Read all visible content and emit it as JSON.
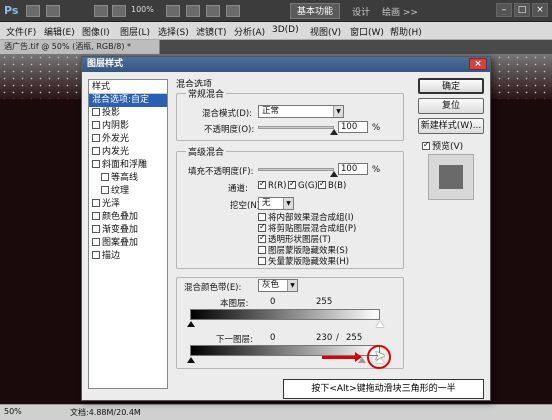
{
  "app": {
    "logo": "Ps",
    "zoom": "100%",
    "workspace_active": "基本功能",
    "workspace_2": "设计",
    "workspace_3": "绘画 >>",
    "window_buttons": [
      "–",
      "□",
      "×"
    ]
  },
  "menubar": [
    "文件(F)",
    "编辑(E)",
    "图像(I)",
    "图层(L)",
    "选择(S)",
    "滤镜(T)",
    "分析(A)",
    "3D(D)",
    "视图(V)",
    "窗口(W)",
    "帮助(H)"
  ],
  "document_tab": "酒广告.tif @ 50% (酒瓶, RGB/8) *",
  "status": {
    "zoom": "50%",
    "doc": "文档:4.88M/20.4M"
  },
  "dialog": {
    "title": "图层样式",
    "close": "×",
    "styles_header": "样式",
    "style_items": [
      {
        "label": "混合选项:自定",
        "checkbox": false,
        "checked": false,
        "selected": true,
        "indent": false
      },
      {
        "label": "投影",
        "checkbox": true,
        "checked": false,
        "selected": false,
        "indent": false
      },
      {
        "label": "内阴影",
        "checkbox": true,
        "checked": false,
        "selected": false,
        "indent": false
      },
      {
        "label": "外发光",
        "checkbox": true,
        "checked": false,
        "selected": false,
        "indent": false
      },
      {
        "label": "内发光",
        "checkbox": true,
        "checked": false,
        "selected": false,
        "indent": false
      },
      {
        "label": "斜面和浮雕",
        "checkbox": true,
        "checked": false,
        "selected": false,
        "indent": false
      },
      {
        "label": "等高线",
        "checkbox": true,
        "checked": false,
        "selected": false,
        "indent": true
      },
      {
        "label": "纹理",
        "checkbox": true,
        "checked": false,
        "selected": false,
        "indent": true
      },
      {
        "label": "光泽",
        "checkbox": true,
        "checked": false,
        "selected": false,
        "indent": false
      },
      {
        "label": "颜色叠加",
        "checkbox": true,
        "checked": false,
        "selected": false,
        "indent": false
      },
      {
        "label": "渐变叠加",
        "checkbox": true,
        "checked": false,
        "selected": false,
        "indent": false
      },
      {
        "label": "图案叠加",
        "checkbox": true,
        "checked": false,
        "selected": false,
        "indent": false
      },
      {
        "label": "描边",
        "checkbox": true,
        "checked": false,
        "selected": false,
        "indent": false
      }
    ],
    "blend_options_title": "混合选项",
    "general": {
      "title": "常规混合",
      "mode_label": "混合模式(D):",
      "mode_value": "正常",
      "opacity_label": "不透明度(O):",
      "opacity_value": "100",
      "opacity_fraction": 1.0,
      "percent": "%"
    },
    "advanced": {
      "title": "高级混合",
      "fill_label": "填充不透明度(F):",
      "fill_value": "100",
      "fill_fraction": 1.0,
      "percent": "%",
      "channels_label": "通道:",
      "channels": [
        {
          "label": "R(R)",
          "checked": true
        },
        {
          "label": "G(G)",
          "checked": true
        },
        {
          "label": "B(B)",
          "checked": true
        }
      ],
      "knockout_label": "挖空(N):",
      "knockout_value": "无",
      "options": [
        {
          "label": "将内部效果混合成组(I)",
          "checked": false
        },
        {
          "label": "将剪贴图层混合成组(P)",
          "checked": true
        },
        {
          "label": "透明形状图层(T)",
          "checked": true
        },
        {
          "label": "图层蒙版隐藏效果(S)",
          "checked": false
        },
        {
          "label": "矢量蒙版隐藏效果(H)",
          "checked": false
        }
      ]
    },
    "blend_if": {
      "label": "混合颜色带(E):",
      "value": "灰色",
      "this_layer_label": "本图层:",
      "this_layer_low": "0",
      "this_layer_high": "255",
      "underlying_label": "下一图层:",
      "underlying_low": "0",
      "underlying_split": "230",
      "underlying_sep": "/",
      "underlying_high": "255"
    },
    "buttons": {
      "ok": "确定",
      "reset": "复位",
      "new_style": "新建样式(W)...",
      "preview_label": "预览(V)",
      "preview_checked": true
    }
  },
  "annotation": {
    "text": "按下<Alt>键拖动滑块三角形的一半",
    "arrow_color": "#dd0000"
  }
}
